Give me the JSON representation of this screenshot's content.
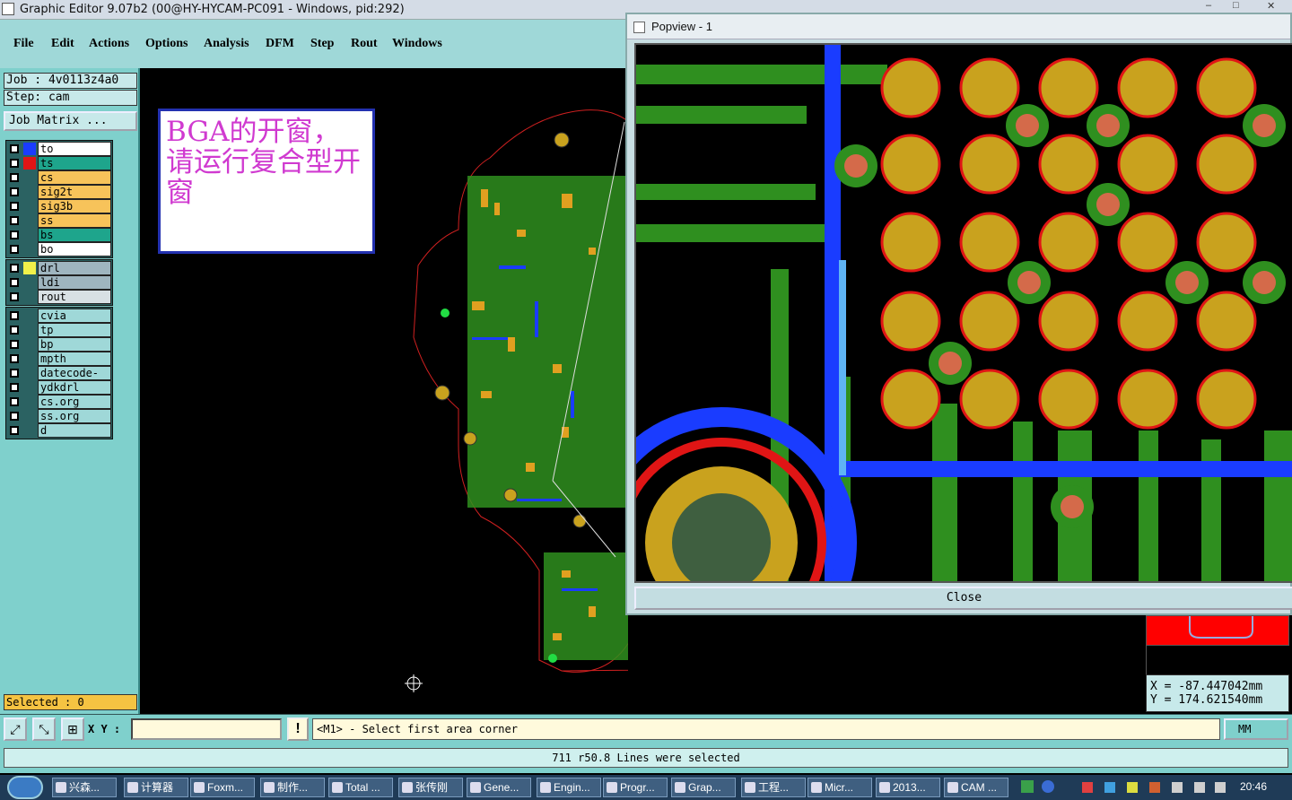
{
  "window": {
    "title": "Graphic Editor 9.07b2 (00@HY-HYCAM-PC091 - Windows, pid:292)"
  },
  "menu": [
    "File",
    "Edit",
    "Actions",
    "Options",
    "Analysis",
    "DFM",
    "Step",
    "Rout",
    "Windows"
  ],
  "job": {
    "job_line": "Job : 4v0113z4a0",
    "step_line": "Step: cam",
    "matrix_button": "Job Matrix ..."
  },
  "layers_board": [
    {
      "name": "to",
      "color": "#ffffff",
      "swatch": "#1a3cff"
    },
    {
      "name": "ts",
      "color": "#1ea58c",
      "swatch": "#e01515"
    },
    {
      "name": "cs",
      "color": "#f7c35a",
      "swatch": "#2b6262"
    },
    {
      "name": "sig2t",
      "color": "#f7c35a",
      "swatch": "#2b6262"
    },
    {
      "name": "sig3b",
      "color": "#f7c35a",
      "swatch": "#2b6262"
    },
    {
      "name": "ss",
      "color": "#f7c35a",
      "swatch": "#2b6262"
    },
    {
      "name": "bs",
      "color": "#1ea58c",
      "swatch": "#2b6262"
    },
    {
      "name": "bo",
      "color": "#ffffff",
      "swatch": "#2b6262"
    }
  ],
  "layers_drill": [
    {
      "name": "drl",
      "color": "#9fb5bf",
      "swatch": "#f1f14a"
    },
    {
      "name": "ldi",
      "color": "#9fb5bf",
      "swatch": "#2b6262"
    },
    {
      "name": "rout",
      "color": "#d8e0e4",
      "swatch": "#2b6262"
    }
  ],
  "layers_misc": [
    {
      "name": "cvia",
      "color": "#9fd8d8",
      "swatch": "#2b6262"
    },
    {
      "name": "tp",
      "color": "#9fd8d8",
      "swatch": "#2b6262"
    },
    {
      "name": "bp",
      "color": "#9fd8d8",
      "swatch": "#2b6262"
    },
    {
      "name": "mpth",
      "color": "#9fd8d8",
      "swatch": "#2b6262"
    },
    {
      "name": "datecode-bs",
      "color": "#9fd8d8",
      "swatch": "#2b6262"
    },
    {
      "name": "ydkdrl",
      "color": "#9fd8d8",
      "swatch": "#2b6262"
    },
    {
      "name": "cs.org",
      "color": "#9fd8d8",
      "swatch": "#2b6262"
    },
    {
      "name": "ss.org",
      "color": "#9fd8d8",
      "swatch": "#2b6262"
    },
    {
      "name": "d",
      "color": "#9fd8d8",
      "swatch": "#2b6262"
    }
  ],
  "selected": "Selected : 0",
  "note": "BGA的开窗，请运行复合型开窗",
  "popview": {
    "title": "Popview - 1",
    "close_label": "Close"
  },
  "coords": {
    "x": "X = -87.447042mm",
    "y": "Y = 174.621540mm"
  },
  "xy_label": "X Y :",
  "warn_label": "!",
  "prompt": "<M1> - Select first area corner",
  "units": "MM",
  "status": "711 r50.8 Lines were selected",
  "taskbar": [
    "兴森...",
    "计算器",
    "Foxm...",
    "制作...",
    "Total ...",
    "张传刚",
    "Gene...",
    "Engin...",
    "Progr...",
    "Grap...",
    "工程...",
    "Micr...",
    "2013...",
    "CAM ..."
  ],
  "clock": "20:46",
  "window_buttons": [
    "–",
    "□",
    "✕"
  ]
}
